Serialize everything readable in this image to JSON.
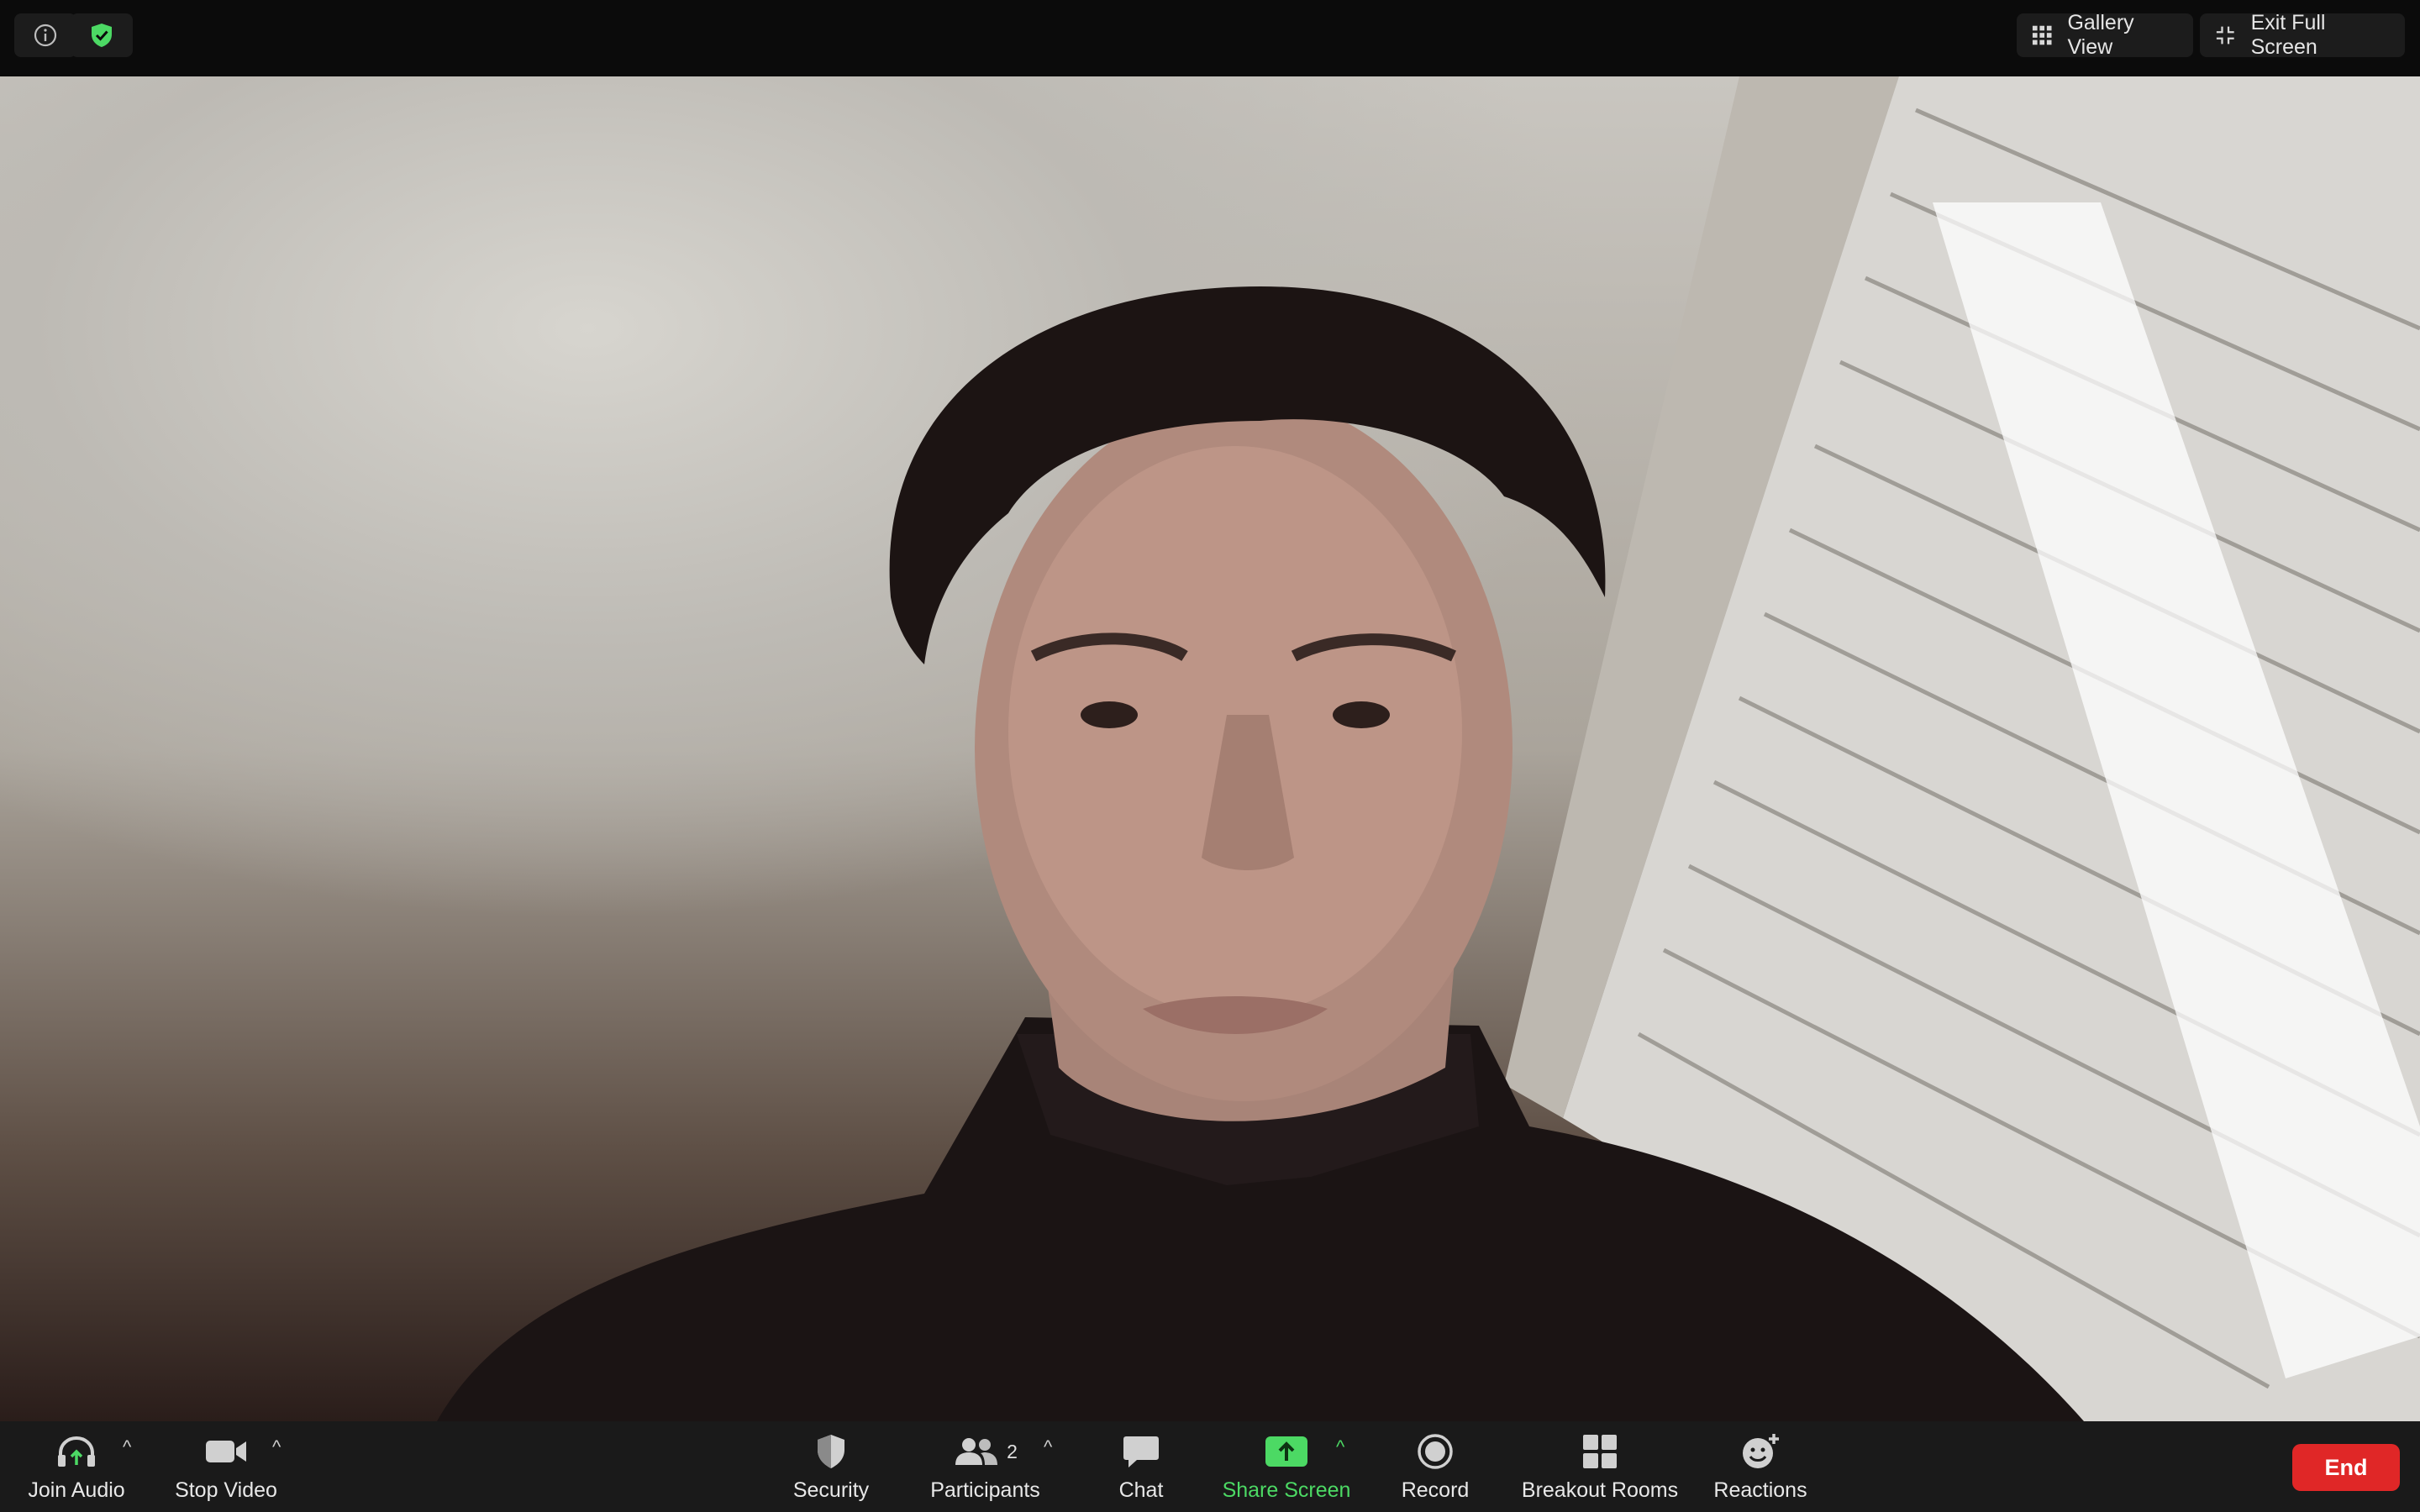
{
  "top_bar": {
    "gallery_view_label": "Gallery View",
    "exit_full_screen_label": "Exit Full Screen"
  },
  "toolbar": {
    "join_audio_label": "Join Audio",
    "stop_video_label": "Stop Video",
    "security_label": "Security",
    "participants_label": "Participants",
    "participants_count": "2",
    "chat_label": "Chat",
    "share_screen_label": "Share Screen",
    "record_label": "Record",
    "breakout_rooms_label": "Breakout Rooms",
    "reactions_label": "Reactions",
    "end_label": "End"
  },
  "colors": {
    "accent_green": "#4cd964",
    "end_red": "#e02727",
    "toolbar_bg": "#1a1a1a"
  },
  "icons": [
    "info-icon",
    "shield-check-icon",
    "grid-icon",
    "exit-full-screen-icon",
    "headphones-icon",
    "video-camera-icon",
    "security-shield-icon",
    "participants-icon",
    "chat-icon",
    "share-screen-icon",
    "record-icon",
    "breakout-rooms-icon",
    "reactions-icon",
    "chevron-up-icon"
  ]
}
